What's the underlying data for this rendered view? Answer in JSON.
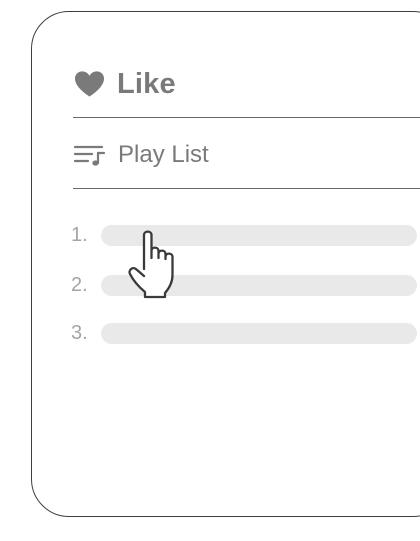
{
  "like": {
    "icon": "heart-icon",
    "label": "Like",
    "icon_color": "#7a7a7a"
  },
  "playlist": {
    "icon": "playlist-icon",
    "label": "Play List"
  },
  "tracks": [
    {
      "number": "1."
    },
    {
      "number": "2."
    },
    {
      "number": "3."
    }
  ],
  "cursor": {
    "icon": "hand-pointer-icon"
  }
}
